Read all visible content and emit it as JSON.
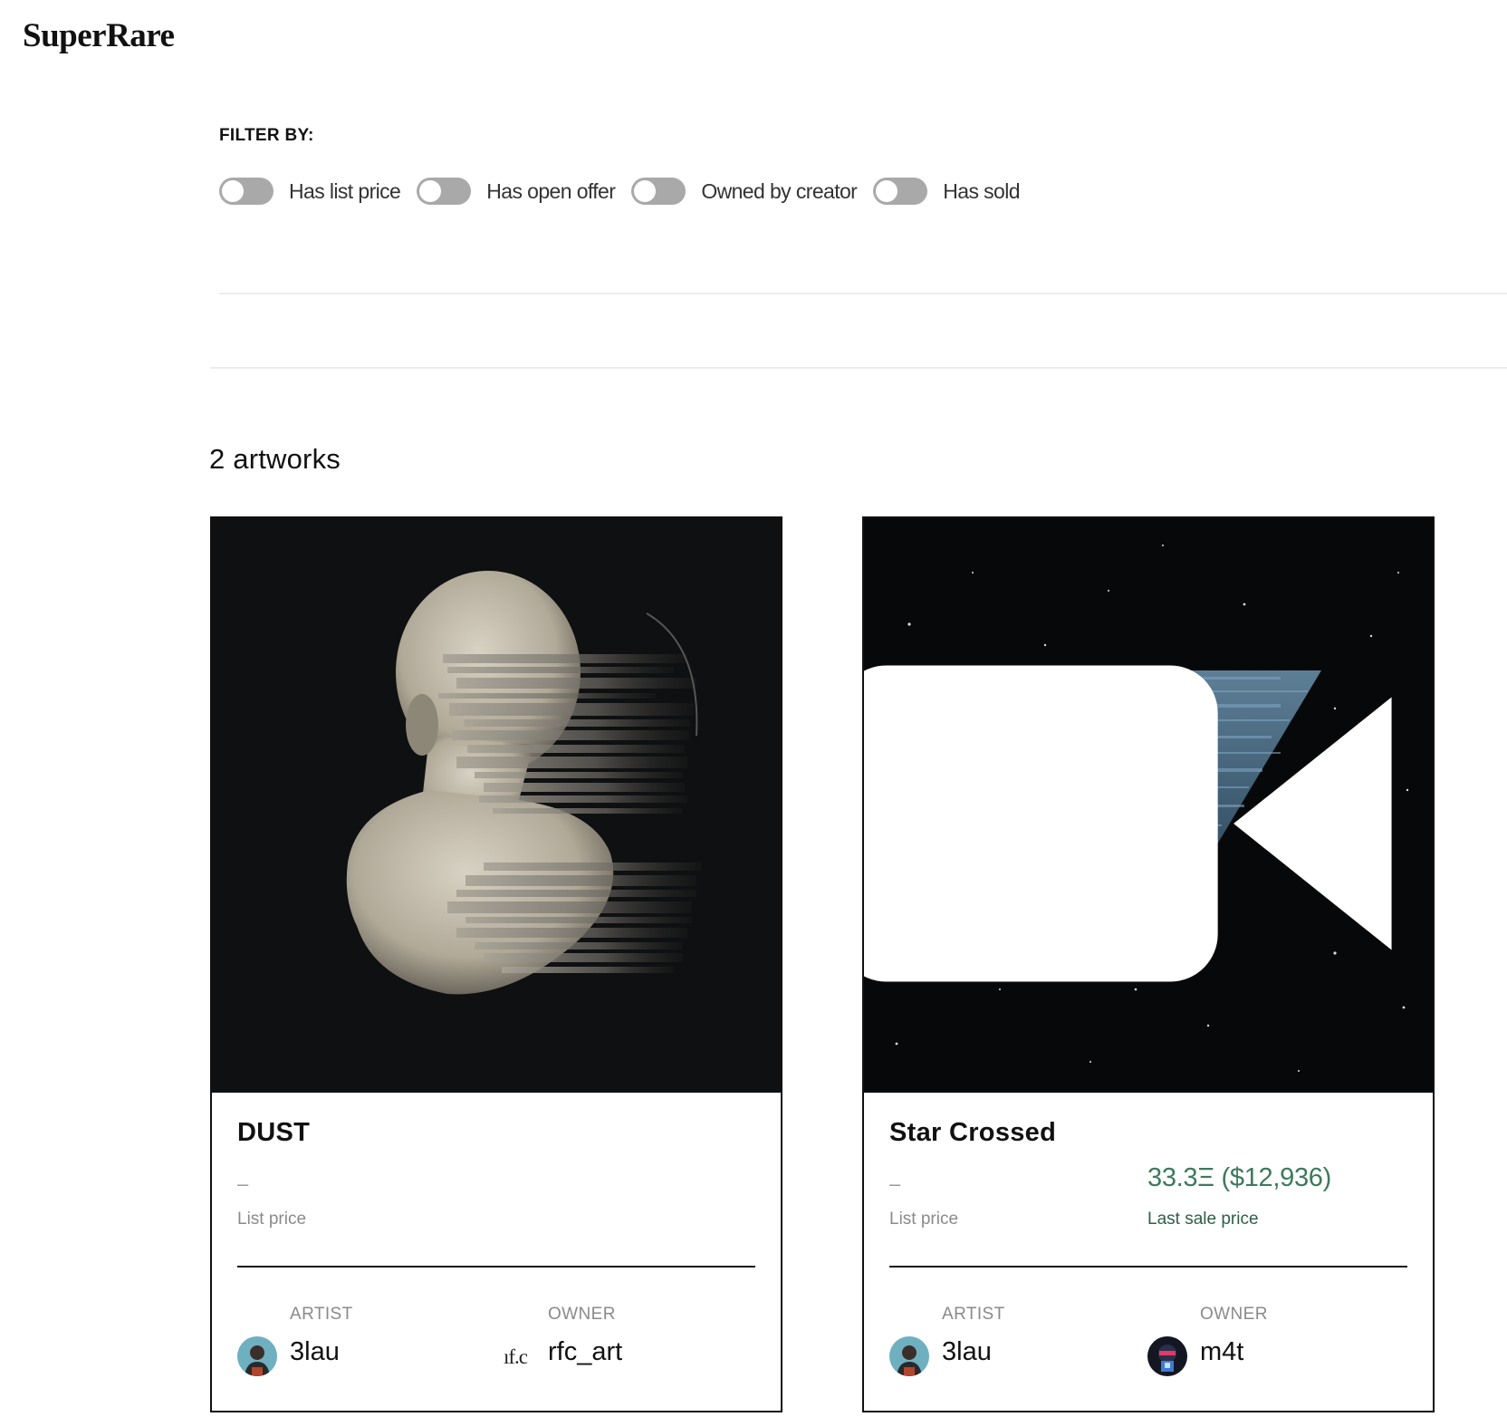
{
  "header": {
    "logo": "SuperRare"
  },
  "filters": {
    "title": "FILTER BY:",
    "items": [
      {
        "label": "Has list price",
        "on": false
      },
      {
        "label": "Has open offer",
        "on": false
      },
      {
        "label": "Owned by creator",
        "on": false
      },
      {
        "label": "Has sold",
        "on": false
      }
    ]
  },
  "results": {
    "count_text": "2 artworks"
  },
  "artworks": [
    {
      "title": "DUST",
      "list_price": "–",
      "list_price_label": "List price",
      "last_sale": "",
      "last_sale_label": "",
      "media_icon": "",
      "artist_label": "ARTIST",
      "artist": "3lau",
      "owner_label": "OWNER",
      "owner": "rfc_art",
      "owner_avatar_text": "ıf.c"
    },
    {
      "title": "Star Crossed",
      "list_price": "–",
      "list_price_label": "List price",
      "last_sale": "33.3Ξ ($12,936)",
      "last_sale_label": "Last sale price",
      "media_icon": "video-camera-icon",
      "artist_label": "ARTIST",
      "artist": "3lau",
      "owner_label": "OWNER",
      "owner": "m4t"
    }
  ],
  "colors": {
    "accent_sale": "#3d7a5c",
    "toggle_off": "#a9a9a9",
    "card_border": "#111111"
  }
}
